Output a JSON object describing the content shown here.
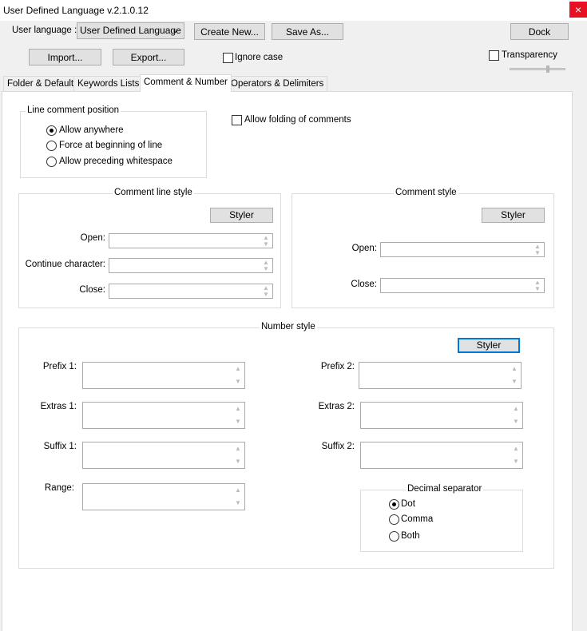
{
  "window": {
    "title": "User Defined Language v.2.1.0.12",
    "close_glyph": "×"
  },
  "toolbar": {
    "user_language_label": "User language :",
    "user_language_value": "User Defined Language",
    "create_new": "Create New...",
    "save_as": "Save As...",
    "dock": "Dock",
    "import": "Import...",
    "export": "Export...",
    "ignore_case": "Ignore case",
    "transparency": "Transparency"
  },
  "tabs": [
    "Folder & Default",
    "Keywords Lists",
    "Comment & Number",
    "Operators & Delimiters"
  ],
  "active_tab": "Comment & Number",
  "line_comment": {
    "title": "Line comment position",
    "options": [
      "Allow anywhere",
      "Force at beginning of line",
      "Allow preceding whitespace"
    ],
    "selected": "Allow anywhere"
  },
  "allow_folding": "Allow folding of comments",
  "comment_line_style": {
    "title": "Comment line style",
    "styler": "Styler",
    "open": "Open:",
    "continue": "Continue character:",
    "close": "Close:"
  },
  "comment_style": {
    "title": "Comment style",
    "styler": "Styler",
    "open": "Open:",
    "close": "Close:"
  },
  "number_style": {
    "title": "Number style",
    "styler": "Styler",
    "prefix1": "Prefix 1:",
    "extras1": "Extras 1:",
    "suffix1": "Suffix 1:",
    "range": "Range:",
    "prefix2": "Prefix 2:",
    "extras2": "Extras 2:",
    "suffix2": "Suffix 2:",
    "decimal": {
      "title": "Decimal separator",
      "options": [
        "Dot",
        "Comma",
        "Both"
      ],
      "selected": "Dot"
    }
  }
}
